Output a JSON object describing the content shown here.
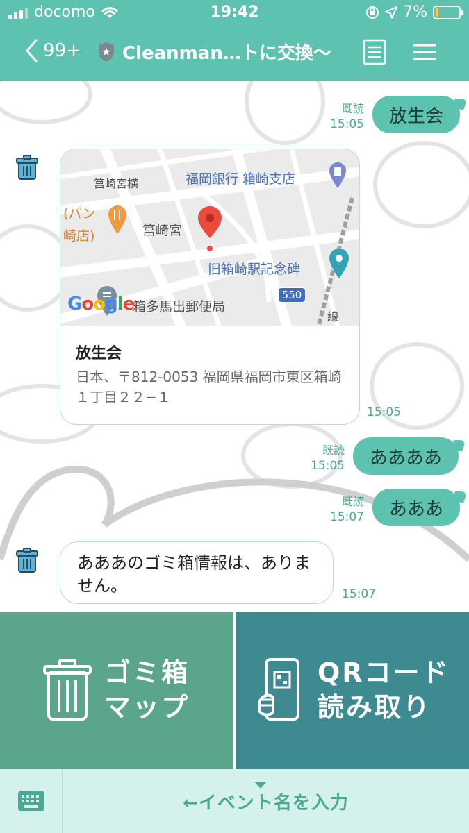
{
  "status_bar": {
    "carrier": "docomo",
    "time": "19:42",
    "battery": "7%",
    "battery_level": 0.07
  },
  "header": {
    "back_count": "99+",
    "chat_title": "Cleanman…トに交換〜"
  },
  "messages": [
    {
      "type": "outgoing",
      "text": "放生会",
      "read": "既読",
      "time": "15:05"
    },
    {
      "type": "incoming-location",
      "place_name": "放生会",
      "address": "日本、〒812-0053 福岡県福岡市東区箱崎１丁目２２−１",
      "time": "15:05"
    },
    {
      "type": "outgoing",
      "text": "ああああ",
      "read": "既読",
      "time": "15:05"
    },
    {
      "type": "outgoing",
      "text": "あああ",
      "read": "既読",
      "time": "15:07"
    },
    {
      "type": "incoming",
      "text": "あああのゴミ箱情報は、ありません。",
      "time": "15:07"
    }
  ],
  "map": {
    "labels": {
      "hakozaki_miyamae": "筥崎宮横",
      "bank": "福岡銀行 箱崎支店",
      "pan": "(パン",
      "pan_store": "崎店)",
      "shrine": "筥崎宮",
      "station_monument": "旧箱崎駅記念碑",
      "post_office": "箱多馬出郵便局",
      "route": "550",
      "line": "線"
    },
    "logo": [
      "G",
      "o",
      "o",
      "g",
      "l",
      "e"
    ]
  },
  "rich_menu": {
    "left_line1": "ゴミ箱",
    "left_line2": "マップ",
    "right_line1": "QRコード",
    "right_line2": "読み取り"
  },
  "input_bar": {
    "text": "←イベント名を入力"
  },
  "colors": {
    "accent": "#5ec2b0",
    "menu_left": "#5aa58b",
    "menu_right": "#3e8a91",
    "input_bg": "#d4f1eb"
  }
}
